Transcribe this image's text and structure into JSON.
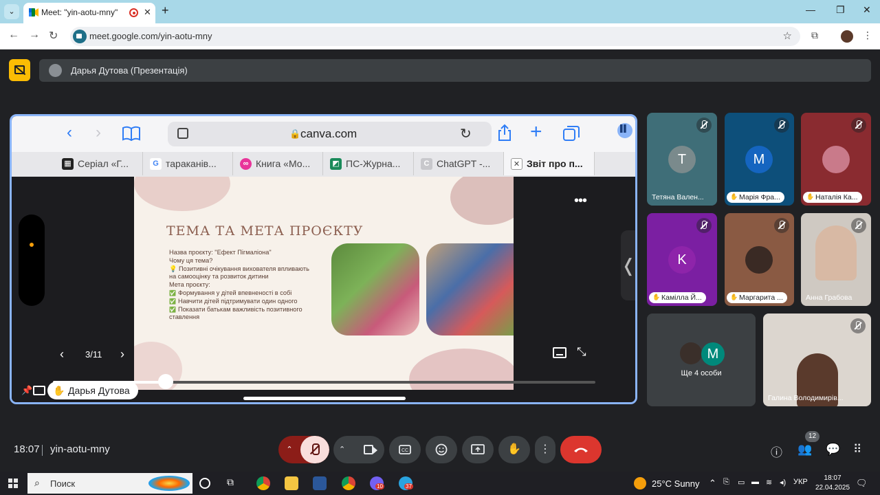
{
  "browser": {
    "tab_title": "Meet: \"yin-aotu-mny\"",
    "tab_close": "✕",
    "new_tab": "+",
    "url": "meet.google.com/yin-aotu-mny",
    "win_min": "—",
    "win_max": "❐",
    "win_close": "✕",
    "icons": [
      "chevron-down-icon",
      "back-arrow-icon",
      "forward-arrow-icon",
      "reload-icon",
      "star-icon",
      "extensions-icon",
      "more-vert-icon"
    ]
  },
  "presenter": {
    "name": "Дарья Дутова (Презентація)"
  },
  "shared_screen": {
    "host": "canva.com",
    "tabs": [
      {
        "label": "Серіал «Г...",
        "favicon": "clapper-icon",
        "color": "#222222"
      },
      {
        "label": "тараканів...",
        "favicon": "google-icon",
        "color": "#4285f4"
      },
      {
        "label": "Книга «Мо...",
        "favicon": "book-app-icon",
        "color": "#e8359a"
      },
      {
        "label": "ПС-Журна...",
        "favicon": "journal-icon",
        "color": "#1a8a5a"
      },
      {
        "label": "ChatGPT -...",
        "favicon": "chatgpt-icon",
        "color": "#c8c8cc"
      },
      {
        "label": "Звіт про п...",
        "favicon": "close-tab-icon",
        "color": "#ffffff"
      }
    ],
    "slide": {
      "title": "ТЕМА ТА МЕТА ПРОЄКТУ",
      "lines": [
        "Назва проєкту: \"Ефект Пігмаліона\"",
        "Чому ця тема?",
        "💡 Позитивні очікування вихователя впливають",
        "на самооцінку та розвиток дитини",
        "Мета проєкту:"
      ],
      "checks": [
        "Формування у дітей впевненості в собі",
        "Навчити дітей підтримувати один одного",
        "Показати батькам важливість позитивного"
      ],
      "last_line": "ставлення"
    },
    "page_counter": "3/11",
    "scrub_progress": 0.2,
    "presenter_label": "Дарья Дутова"
  },
  "participants": [
    {
      "name": "Тетяна Вален...",
      "initial": "T",
      "bg": "#3f6e78",
      "avatar": "#7a8a8c",
      "muted": true,
      "hand": false
    },
    {
      "name": "Марія Фра...",
      "initial": "M",
      "bg": "#0d4f7a",
      "avatar": "#1565c0",
      "muted": true,
      "hand": true
    },
    {
      "name": "Наталія Ка...",
      "initial": "",
      "bg": "#8a2b30",
      "avatar": "#c97a8a",
      "muted": true,
      "hand": true
    },
    {
      "name": "Камілла Й...",
      "initial": "K",
      "bg": "#7b1fa2",
      "avatar": "#8e24aa",
      "muted": true,
      "hand": true
    },
    {
      "name": "Маргарита ...",
      "initial": "",
      "bg": "#8a5a43",
      "avatar": "#3a2a24",
      "muted": true,
      "hand": true
    },
    {
      "name": "Анна Грабова",
      "initial": "",
      "bg": "#cfc9c2",
      "avatar": "#d8b9a4",
      "muted": true,
      "hand": false
    },
    {
      "name": "Ще 4 особи",
      "initial": "M",
      "bg": "#3c4043",
      "avatar": "#00897b",
      "muted": false,
      "hand": false
    },
    {
      "name": "Галина Володимирів...",
      "initial": "",
      "bg": "#dcd6cf",
      "avatar": "#5a3a2c",
      "muted": true,
      "hand": false
    }
  ],
  "controls": {
    "time": "18:07",
    "meeting_code": "yin-aotu-mny",
    "people_count": "12",
    "icons": [
      "mic-off-icon",
      "camera-icon",
      "captions-icon",
      "emoji-icon",
      "present-icon",
      "raise-hand-icon",
      "more-vert-icon",
      "end-call-icon",
      "info-icon",
      "people-icon",
      "chat-icon",
      "activities-icon"
    ]
  },
  "taskbar": {
    "search_placeholder": "Поиск",
    "weather": "25°C  Sunny",
    "lang": "УКР",
    "clock_time": "18:07",
    "clock_date": "22.04.2025",
    "badge_viber": "10",
    "badge_telegram": "37"
  }
}
